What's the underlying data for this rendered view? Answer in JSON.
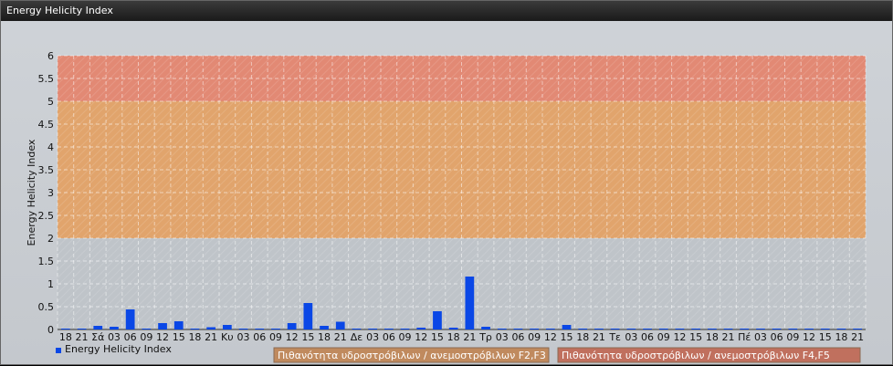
{
  "window": {
    "title": "Energy Helicity Index"
  },
  "chart_data": {
    "type": "bar",
    "ylabel": "Energy Helicity Index",
    "ylim": [
      0,
      6
    ],
    "yticks": [
      "0",
      "0.5",
      "1",
      "1.5",
      "2",
      "2.5",
      "3",
      "3.5",
      "4",
      "4.5",
      "5",
      "5.5",
      "6"
    ],
    "grid": true,
    "bar_color": "#0a47e6",
    "bands": [
      {
        "from": 0,
        "to": 2,
        "color": "#bfc4c9"
      },
      {
        "from": 2,
        "to": 5,
        "color": "#e3a267"
      },
      {
        "from": 5,
        "to": 6,
        "color": "#e48670"
      }
    ],
    "categories": [
      "18",
      "21",
      "Σά",
      "03",
      "06",
      "09",
      "12",
      "15",
      "18",
      "21",
      "Κυ",
      "03",
      "06",
      "09",
      "12",
      "15",
      "18",
      "21",
      "Δε",
      "03",
      "06",
      "09",
      "12",
      "15",
      "18",
      "21",
      "Τρ",
      "03",
      "06",
      "09",
      "12",
      "15",
      "18",
      "21",
      "Τε",
      "03",
      "06",
      "09",
      "12",
      "15",
      "18",
      "21",
      "Πέ",
      "03",
      "06",
      "09",
      "12",
      "15",
      "18",
      "21"
    ],
    "series": [
      {
        "name": "Energy Helicity Index",
        "values": [
          0.02,
          0.02,
          0.08,
          0.06,
          0.44,
          0.02,
          0.14,
          0.18,
          0.02,
          0.05,
          0.1,
          0.02,
          0.02,
          0.02,
          0.14,
          0.58,
          0.08,
          0.17,
          0.02,
          0.02,
          0.02,
          0.02,
          0.04,
          0.4,
          0.04,
          1.16,
          0.06,
          0.02,
          0.02,
          0.02,
          0.02,
          0.1,
          0.02,
          0.02,
          0.02,
          0.02,
          0.02,
          0.02,
          0.02,
          0.02,
          0.02,
          0.02,
          0.02,
          0.02,
          0.02,
          0.02,
          0.02,
          0.02,
          0.02,
          0.02
        ]
      }
    ],
    "legend": {
      "position": "bottom-left",
      "band_items": [
        {
          "label": "Πιθανότητα υδροστρόβιλων / ανεμοστρόβιλων F2,F3",
          "color": "#c08a5e"
        },
        {
          "label": "Πιθανότητα υδροστρόβιλων / ανεμοστρόβιλων F4,F5",
          "color": "#c0705e"
        }
      ]
    }
  }
}
